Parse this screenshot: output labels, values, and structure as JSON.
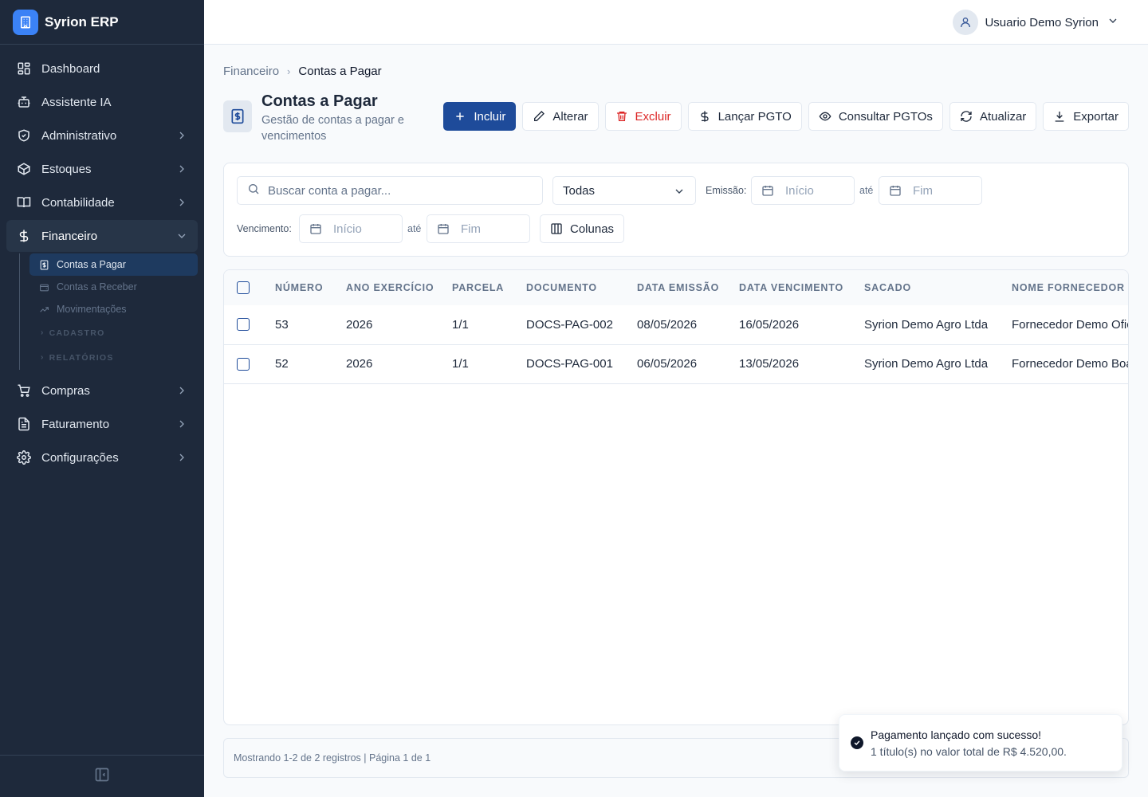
{
  "app": {
    "name": "Syrion ERP",
    "icon": "building-icon"
  },
  "user": {
    "name": "Usuario Demo Syrion",
    "icon": "user-icon"
  },
  "sidebar": {
    "items": [
      {
        "label": "Dashboard",
        "icon": "layout-dashboard-icon"
      },
      {
        "label": "Assistente IA",
        "icon": "bot-icon"
      },
      {
        "label": "Administrativo",
        "icon": "shield-icon"
      },
      {
        "label": "Estoques",
        "icon": "box-icon"
      },
      {
        "label": "Contabilidade",
        "icon": "book-open-icon"
      },
      {
        "label": "Financeiro",
        "icon": "dollar-sign-icon",
        "expanded": true
      }
    ],
    "financeiro_sub": [
      {
        "label": "Contas a Pagar",
        "icon": "receipt-icon",
        "active": true
      },
      {
        "label": "Contas a Receber",
        "icon": "wallet-icon"
      },
      {
        "label": "Movimentações",
        "icon": "trending-up-icon"
      }
    ],
    "financeiro_groups": [
      "CADASTRO",
      "RELATÓRIOS"
    ],
    "items_after": [
      {
        "label": "Compras",
        "icon": "shopping-cart-icon"
      },
      {
        "label": "Faturamento",
        "icon": "file-text-icon"
      },
      {
        "label": "Configurações",
        "icon": "settings-icon"
      }
    ]
  },
  "breadcrumb": {
    "parent": "Financeiro",
    "current": "Contas a Pagar"
  },
  "page": {
    "title": "Contas a Pagar",
    "subtitle": "Gestão de contas a pagar e vencimentos"
  },
  "toolbar": {
    "incluir": "Incluir",
    "alterar": "Alterar",
    "excluir": "Excluir",
    "lancar": "Lançar PGTO",
    "consultar": "Consultar PGTOs",
    "atualizar": "Atualizar",
    "exportar": "Exportar"
  },
  "filters": {
    "search_placeholder": "Buscar conta a pagar...",
    "status_value": "Todas",
    "emissao_label": "Emissão:",
    "vencimento_label": "Vencimento:",
    "start_placeholder": "Início",
    "end_placeholder": "Fim",
    "ate": "até",
    "colunas": "Colunas"
  },
  "table": {
    "columns": [
      "NÚMERO",
      "ANO EXERCÍCIO",
      "PARCELA",
      "DOCUMENTO",
      "DATA EMISSÃO",
      "DATA VENCIMENTO",
      "SACADO",
      "NOME FORNECEDOR"
    ],
    "rows": [
      {
        "numero": "53",
        "ano": "2026",
        "parcela": "1/1",
        "documento": "DOCS-PAG-002",
        "emissao": "08/05/2026",
        "vencimento": "16/05/2026",
        "sacado": "Syrion Demo Agro Ltda",
        "fornecedor": "Fornecedor Demo Ofic"
      },
      {
        "numero": "52",
        "ano": "2026",
        "parcela": "1/1",
        "documento": "DOCS-PAG-001",
        "emissao": "06/05/2026",
        "vencimento": "13/05/2026",
        "sacado": "Syrion Demo Agro Ltda",
        "fornecedor": "Fornecedor Demo Boa"
      }
    ]
  },
  "pagination": {
    "summary": "Mostrando 1-2 de 2 registros | Página 1 de 1"
  },
  "toast": {
    "title": "Pagamento lançado com sucesso!",
    "description": "1 título(s) no valor total de R$ 4.520,00.",
    "icon": "check-circle-icon"
  },
  "colors": {
    "sidebar": "#1e293b",
    "primary": "#1e4b9a",
    "danger": "#dc2626",
    "brand": "#3b82f6"
  }
}
